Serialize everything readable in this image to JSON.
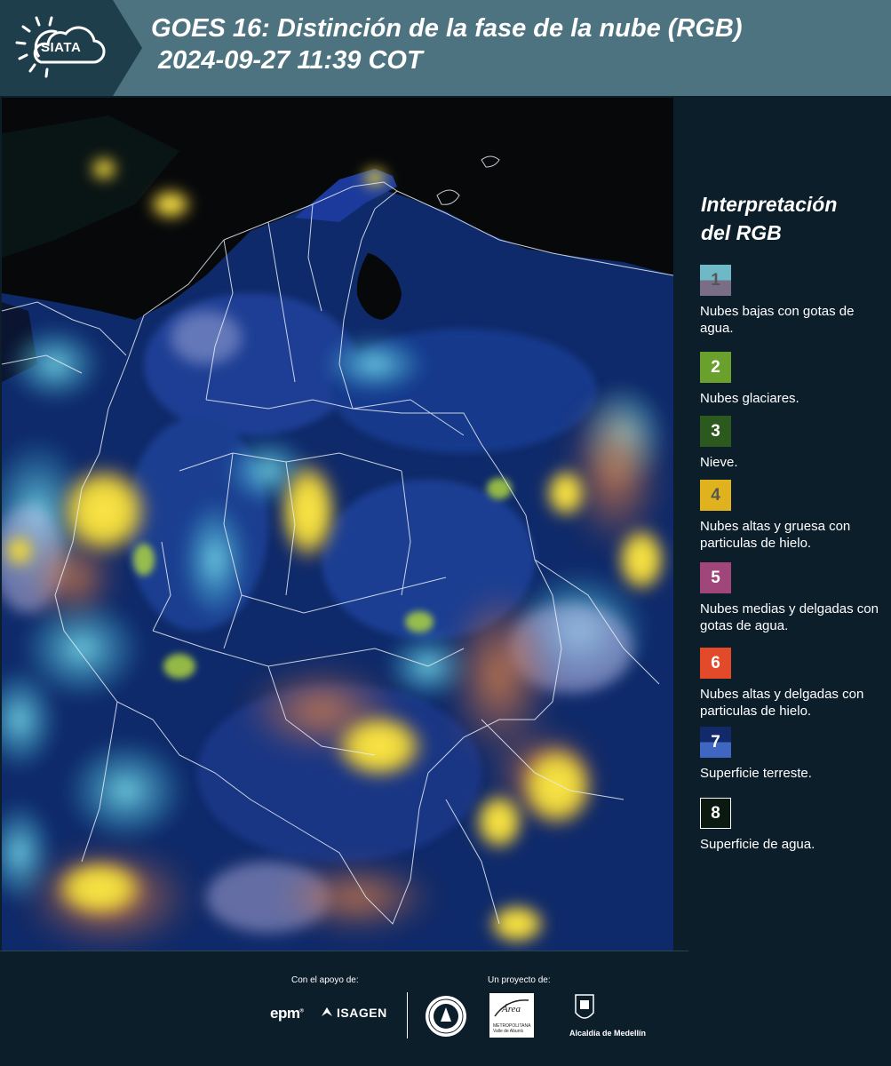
{
  "header": {
    "logo_text": "SIATA",
    "title_line1": "GOES 16: Distinción de la fase de la nube (RGB)",
    "title_line2": "2024-09-27 11:39 COT"
  },
  "map": {
    "icon": "satellite-rgb-image",
    "background_color": "#0a1a3e"
  },
  "legend": {
    "title_line1": "Interpretación",
    "title_line2": "del RGB",
    "items": [
      {
        "number": "1",
        "label": "Nubes bajas con gotas de agua.",
        "color_top": "#6fb9c7",
        "color_bottom": "#7a6e87"
      },
      {
        "number": "2",
        "label": "Nubes glaciares.",
        "color_top": "#6aa12c",
        "color_bottom": "#6aa12c"
      },
      {
        "number": "3",
        "label": "Nieve.",
        "color_top": "#2c5a1e",
        "color_bottom": "#2c5a1e"
      },
      {
        "number": "4",
        "label": "Nubes altas y gruesa con particulas de hielo.",
        "color_top": "#e0b21d",
        "color_bottom": "#e0b21d"
      },
      {
        "number": "5",
        "label": "Nubes medias y delgadas con gotas de agua.",
        "color_top": "#a0467a",
        "color_bottom": "#a0467a"
      },
      {
        "number": "6",
        "label": "Nubes altas y delgadas con particulas de hielo.",
        "color_top": "#e24a2a",
        "color_bottom": "#e24a2a"
      },
      {
        "number": "7",
        "label": "Superficie terreste.",
        "color_top": "#132a6a",
        "color_bottom": "#3f67c2"
      },
      {
        "number": "8",
        "label": "Superficie de agua.",
        "color_top": "#0a1a10",
        "color_bottom": "#0a1a10"
      }
    ]
  },
  "footer": {
    "support_label": "Con el apoyo de:",
    "project_label": "Un proyecto de:",
    "epm": "epm",
    "isagen": "ISAGEN",
    "amva_line1": "Área",
    "amva_line2": "METROPOLITANA",
    "amva_line3": "Valle de Aburrá",
    "medellin": "Alcaldía de Medellín"
  },
  "colors": {
    "header_bg": "#4d7380",
    "logo_bg": "#1e3e4c",
    "page_bg": "#0d1e2b",
    "text": "#ffffff"
  }
}
